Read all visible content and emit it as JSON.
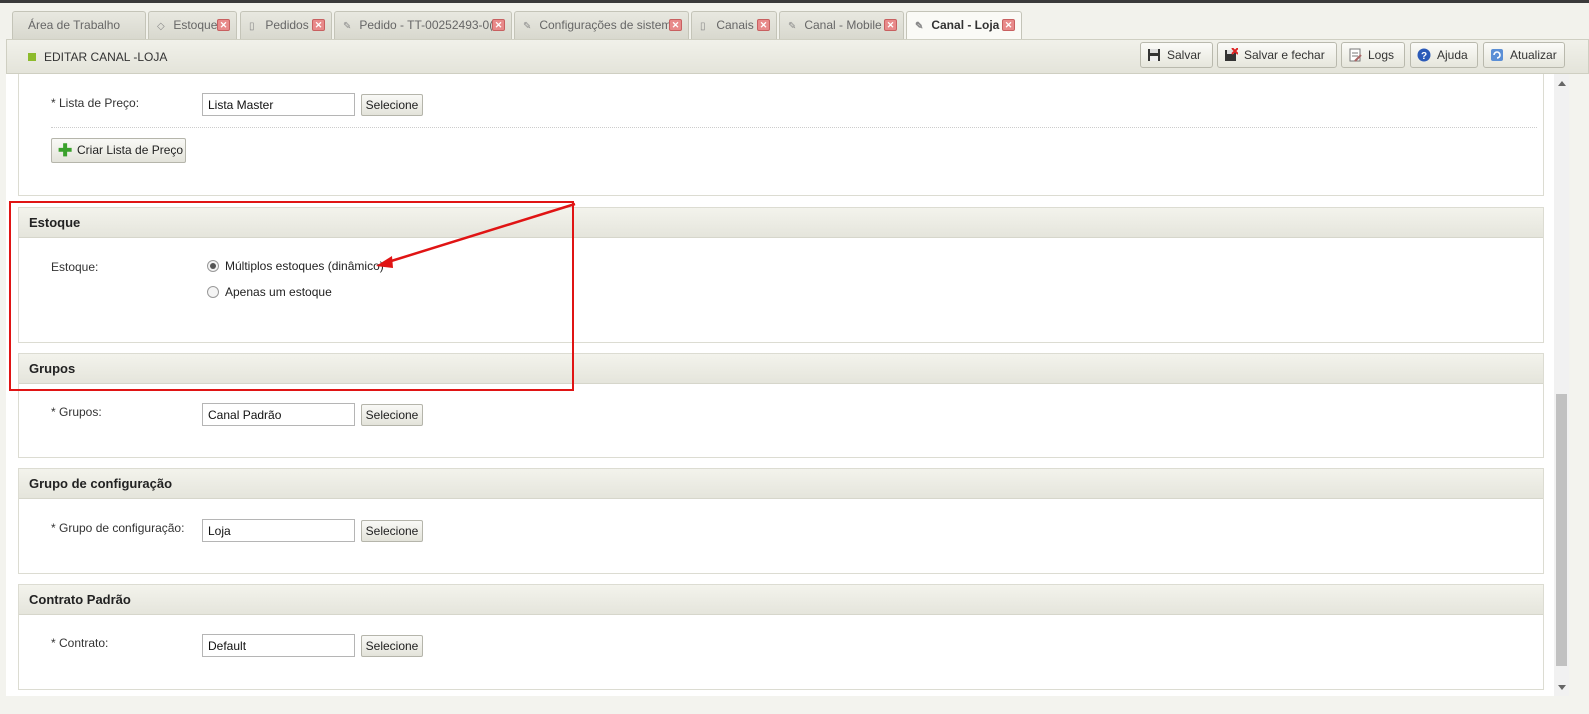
{
  "tabs": [
    {
      "label": "Área de Trabalho",
      "icon": "",
      "closable": false
    },
    {
      "label": "Estoque",
      "icon": "cube-icon",
      "closable": true
    },
    {
      "label": "Pedidos",
      "icon": "document-icon",
      "closable": true
    },
    {
      "label": "Pedido - TT-00252493-0(",
      "icon": "pencil-icon",
      "closable": true
    },
    {
      "label": "Configurações de sistem",
      "icon": "pencil-icon",
      "closable": true
    },
    {
      "label": "Canais",
      "icon": "document-icon",
      "closable": true
    },
    {
      "label": "Canal - Mobile",
      "icon": "pencil-icon",
      "closable": true
    },
    {
      "label": "Canal - Loja",
      "icon": "pencil-icon",
      "closable": true,
      "active": true
    }
  ],
  "header": {
    "title": "EDITAR CANAL -LOJA",
    "buttons": {
      "save": "Salvar",
      "save_close": "Salvar e fechar",
      "logs": "Logs",
      "help": "Ajuda",
      "refresh": "Atualizar"
    }
  },
  "price_list": {
    "label": "* Lista de Preço:",
    "value": "Lista Master",
    "select_button": "Selecione",
    "create_button": "Criar Lista de Preço"
  },
  "stock": {
    "section_title": "Estoque",
    "label": "Estoque:",
    "options": [
      "Múltiplos estoques (dinâmico)",
      "Apenas um estoque"
    ],
    "selected_index": 0
  },
  "groups": {
    "section_title": "Grupos",
    "label": "* Grupos:",
    "value": "Canal Padrão",
    "select_button": "Selecione"
  },
  "config_group": {
    "section_title": "Grupo de configuração",
    "label": "* Grupo de configuração:",
    "value": "Loja",
    "select_button": "Selecione"
  },
  "contract": {
    "section_title": "Contrato Padrão",
    "label": "* Contrato:",
    "value": "Default",
    "select_button": "Selecione"
  },
  "colors": {
    "annotation": "#e01414",
    "accent": "#8dbb2c"
  }
}
